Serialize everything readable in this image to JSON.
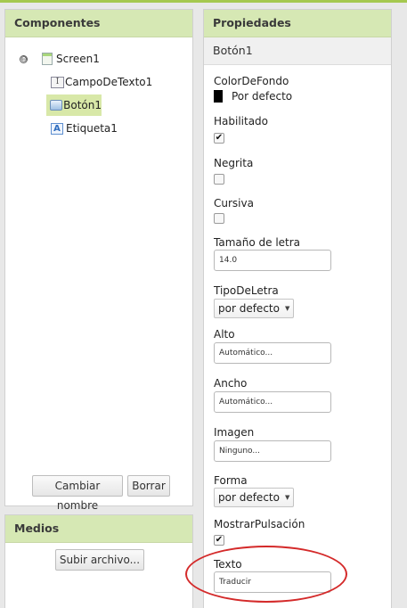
{
  "components_panel": {
    "title": "Componentes",
    "tree": [
      {
        "label": "Screen1",
        "icon": "screen-icon"
      },
      {
        "label": "CampoDeTexto1",
        "icon": "textbox-icon"
      },
      {
        "label": "Botón1",
        "icon": "button-icon",
        "selected": true
      },
      {
        "label": "Etiqueta1",
        "icon": "label-icon"
      }
    ],
    "collapse_symbol": "⊖",
    "rename_button": "Cambiar nombre",
    "delete_button": "Borrar"
  },
  "media_panel": {
    "title": "Medios",
    "upload_button": "Subir archivo..."
  },
  "properties_panel": {
    "title": "Propiedades",
    "component": "Botón1",
    "background_color": {
      "label": "ColorDeFondo",
      "value": "Por defecto",
      "swatch": "#000000"
    },
    "enabled": {
      "label": "Habilitado",
      "checked": true,
      "mark": "✔"
    },
    "bold": {
      "label": "Negrita",
      "checked": false
    },
    "italic": {
      "label": "Cursiva",
      "checked": false
    },
    "font_size": {
      "label": "Tamaño de letra",
      "value": "14.0"
    },
    "font_type": {
      "label": "TipoDeLetra",
      "value": "por defecto",
      "caret": "▼"
    },
    "height": {
      "label": "Alto",
      "value": "Automático..."
    },
    "width": {
      "label": "Ancho",
      "value": "Automático..."
    },
    "image": {
      "label": "Imagen",
      "value": "Ninguno..."
    },
    "shape": {
      "label": "Forma",
      "value": "por defecto",
      "caret": "▼"
    },
    "show_feedback": {
      "label": "MostrarPulsación",
      "checked": true,
      "mark": "✔"
    },
    "text": {
      "label": "Texto",
      "value": "Traducir"
    }
  },
  "colors": {
    "header_green": "#d6e8b4",
    "top_bar": "#a5c84f",
    "selection": "#d8e8a8",
    "annotation_red": "#d42a2a"
  }
}
